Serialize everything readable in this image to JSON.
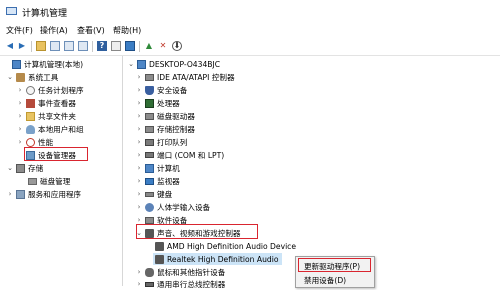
{
  "window": {
    "title": "计算机管理"
  },
  "menu": [
    "文件(F)",
    "操作(A)",
    "查看(V)",
    "帮助(H)"
  ],
  "toolbar": {
    "back": "◀",
    "forward": "▶",
    "up": "↑",
    "help": "?",
    "remove": "✕",
    "download": "⬇"
  },
  "left_tree": [
    {
      "label": "计算机管理(本地)",
      "icon": "computer-icon"
    },
    {
      "label": "系统工具",
      "icon": "tools-icon"
    },
    {
      "label": "任务计划程序",
      "icon": "clock-icon"
    },
    {
      "label": "事件查看器",
      "icon": "event-log-icon"
    },
    {
      "label": "共享文件夹",
      "icon": "folder-icon"
    },
    {
      "label": "本地用户和组",
      "icon": "users-icon"
    },
    {
      "label": "性能",
      "icon": "performance-icon"
    },
    {
      "label": "设备管理器",
      "icon": "device-manager-icon"
    },
    {
      "label": "存储",
      "icon": "storage-icon"
    },
    {
      "label": "磁盘管理",
      "icon": "disk-icon"
    },
    {
      "label": "服务和应用程序",
      "icon": "services-icon"
    }
  ],
  "right_tree": {
    "root": "DESKTOP-O434BJC",
    "items": [
      "IDE ATA/ATAPI 控制器",
      "安全设备",
      "处理器",
      "磁盘驱动器",
      "存储控制器",
      "打印队列",
      "端口 (COM 和 LPT)",
      "计算机",
      "监视器",
      "键盘",
      "人体学输入设备",
      "软件设备",
      "声音、视频和游戏控制器",
      "AMD High Definition Audio Device",
      "Realtek High Definition Audio",
      "鼠标和其他指针设备",
      "通用串行总线控制器"
    ]
  },
  "context_menu": {
    "items": [
      "更新驱动程序(P)",
      "禁用设备(D)"
    ]
  },
  "colors": {
    "highlight": "#d9252f",
    "selection": "#cce4f7"
  }
}
